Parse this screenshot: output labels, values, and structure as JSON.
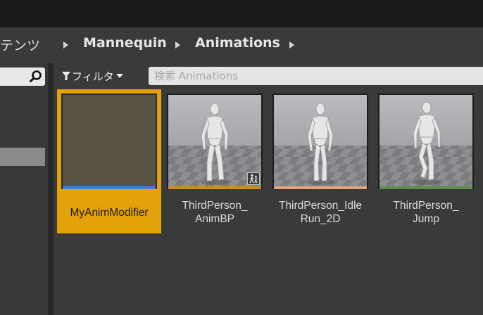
{
  "breadcrumb": {
    "items": [
      "テンツ",
      "Mannequin",
      "Animations"
    ]
  },
  "filter": {
    "label": "フィルタ"
  },
  "search": {
    "placeholder": "検索 Animations",
    "value": ""
  },
  "assets": [
    {
      "label": "MyAnimModifier",
      "type": "anim-modifier",
      "bar_color": "#3d7de0",
      "selected": true
    },
    {
      "label": "ThirdPerson_\nAnimBP",
      "type": "animation-blueprint",
      "bar_color": "#d08a1e",
      "selected": false
    },
    {
      "label": "ThirdPerson_Idle\nRun_2D",
      "type": "blend-space",
      "bar_color": "#e8a17a",
      "selected": false
    },
    {
      "label": "ThirdPerson_\nJump",
      "type": "animation-sequence",
      "bar_color": "#5f8d4a",
      "selected": false
    }
  ],
  "colors": {
    "selection": "#e3a10a",
    "panel": "#3a3a3a",
    "topbar": "#1a1a1a"
  }
}
